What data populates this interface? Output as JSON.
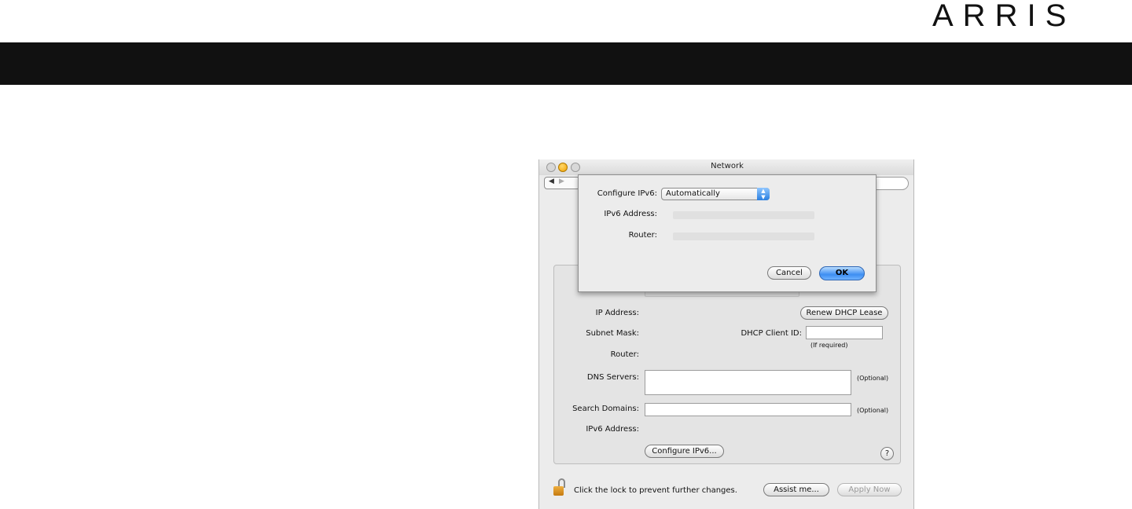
{
  "brand": {
    "logo_text": "ARRIS"
  },
  "window": {
    "title": "Network"
  },
  "panel": {
    "ip_address_label": "IP Address:",
    "subnet_mask_label": "Subnet Mask:",
    "router_label": "Router:",
    "renew_dhcp_label": "Renew DHCP Lease",
    "dhcp_client_id_label": "DHCP Client ID:",
    "dhcp_client_id_value": "",
    "if_required_note": "(If required)",
    "dns_servers_label": "DNS Servers:",
    "dns_servers_value": "",
    "optional_label_1": "(Optional)",
    "search_domains_label": "Search Domains:",
    "search_domains_value": "",
    "optional_label_2": "(Optional)",
    "ipv6_address_label": "IPv6 Address:",
    "configure_ipv6_button": "Configure IPv6...",
    "help_icon_glyph": "?"
  },
  "footer": {
    "lock_text": "Click the lock to prevent further changes.",
    "assist_button": "Assist me...",
    "apply_button": "Apply Now"
  },
  "sheet": {
    "configure_ipv6_label": "Configure IPv6:",
    "configure_ipv6_selected": "Automatically",
    "ipv6_address_label": "IPv6 Address:",
    "router_label": "Router:",
    "cancel_button": "Cancel",
    "ok_button": "OK"
  },
  "colors": {
    "top_bar": "#111111",
    "ok_button": "#3d8ef2",
    "lock": "#e0a030"
  },
  "icons": [
    "traffic-light-close-icon",
    "traffic-light-minimize-icon",
    "traffic-light-zoom-icon",
    "back-arrow-icon",
    "forward-arrow-icon",
    "lock-icon",
    "help-icon",
    "popup-arrows-icon"
  ]
}
